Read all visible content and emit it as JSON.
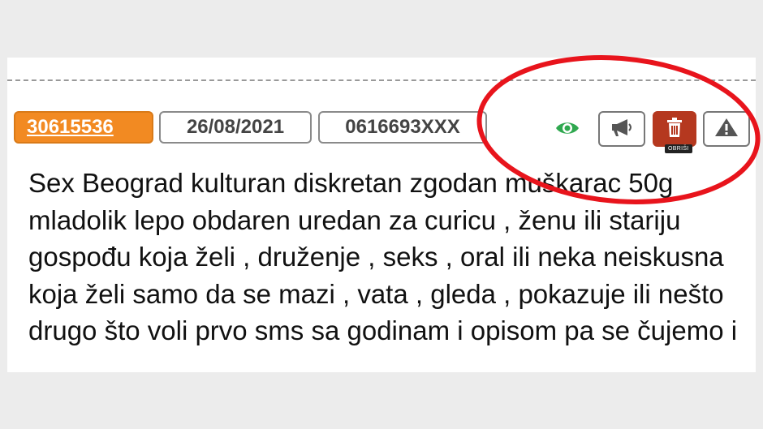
{
  "listing": {
    "id": "30615536",
    "date": "26/08/2021",
    "phone": "0616693XXX",
    "text": "Sex Beograd kulturan diskretan zgodan muškarac 50g mladolik lepo obdaren uredan za curicu , ženu ili stariju gospođu koja želi , druženje , seks , oral ili neka neiskusna koja želi samo da se mazi , vata , gleda , pokazuje ili nešto drugo što voli prvo sms sa godinam i opisom pa se čujemo i"
  },
  "actions": {
    "view_icon": "eye-icon",
    "promote_icon": "megaphone-icon",
    "delete_icon": "trash-icon",
    "delete_tooltip": "OBRIŠI",
    "report_icon": "warning-icon"
  },
  "colors": {
    "id_tag": "#f28a22",
    "delete_button": "#b5381f",
    "eye": "#2fa84f",
    "annotation_circle": "#e8141c"
  }
}
